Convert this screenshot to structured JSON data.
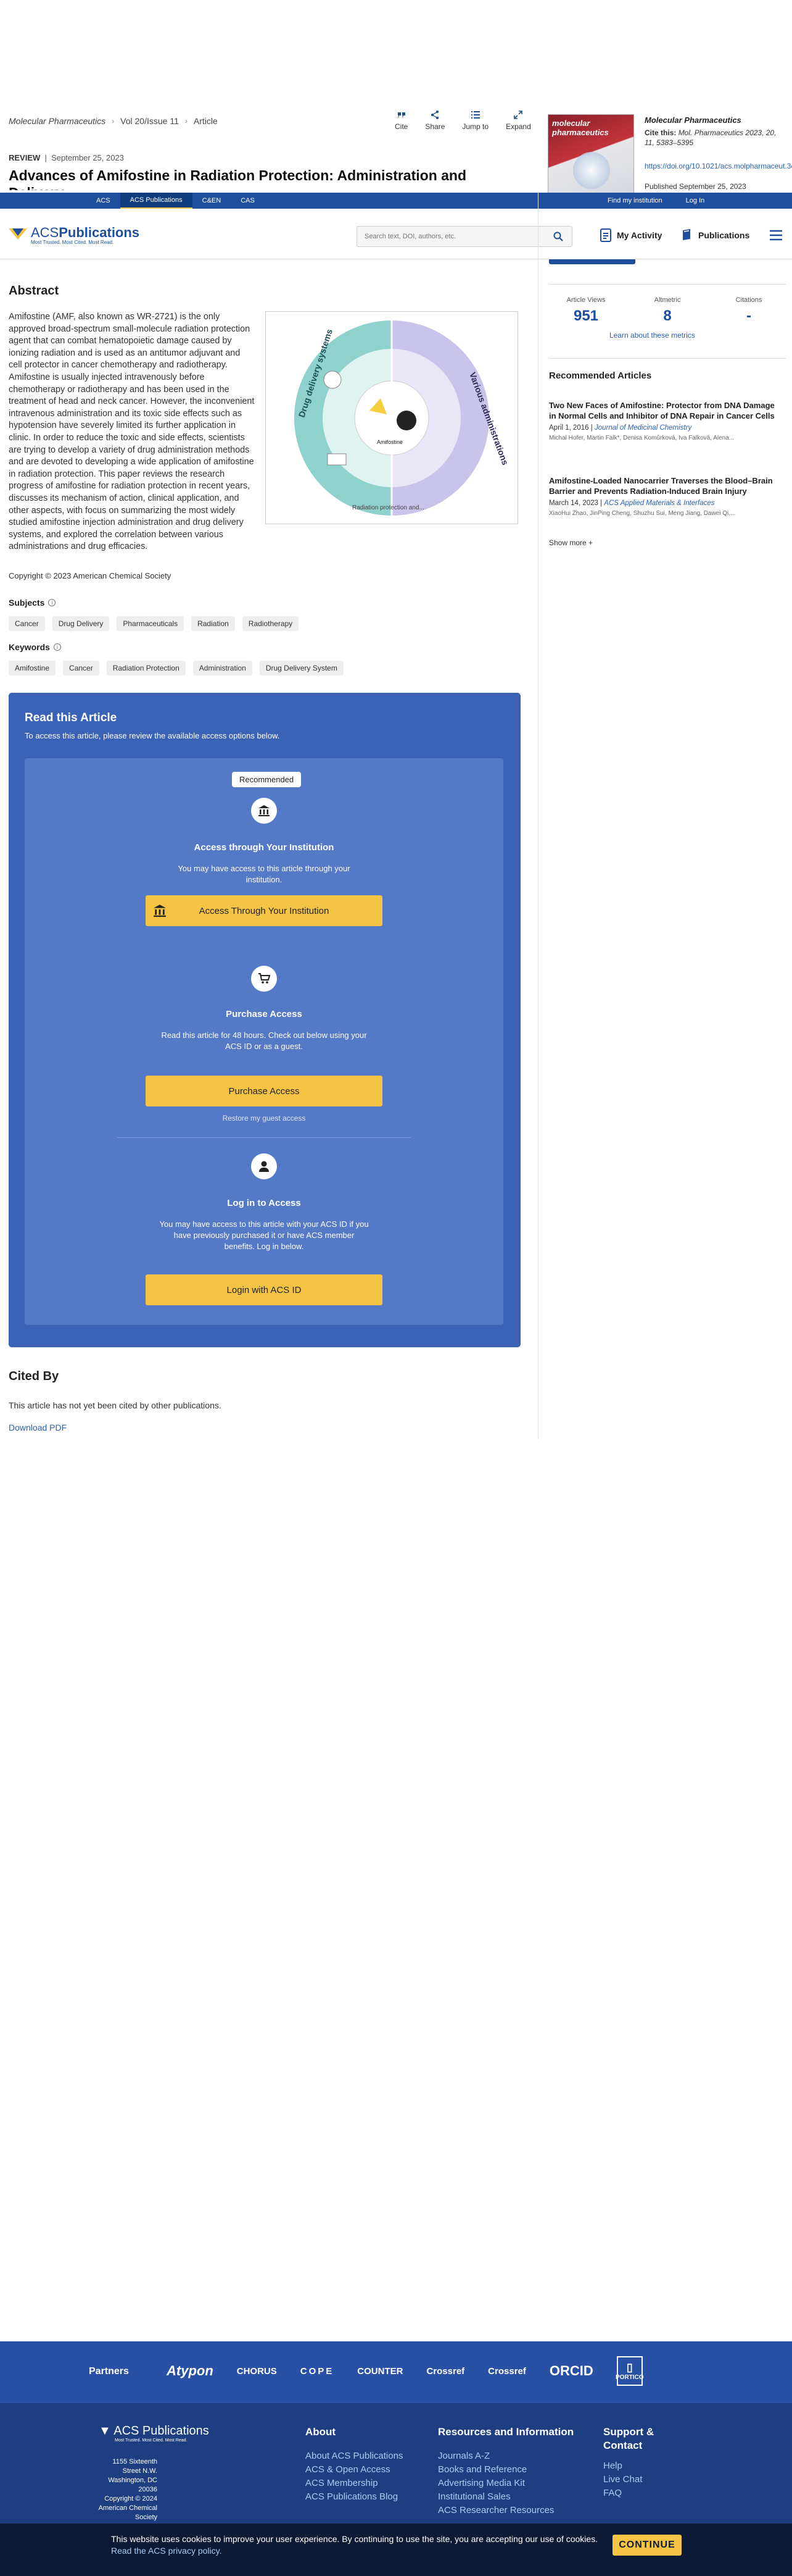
{
  "breadcrumb": {
    "journal": "Molecular Pharmaceutics",
    "volume": "Vol 20/Issue 11",
    "article": "Article"
  },
  "toolbar": {
    "cite": "Cite",
    "share": "Share",
    "jump": "Jump to",
    "expand": "Expand"
  },
  "article": {
    "type": "REVIEW",
    "date": "September 25, 2023",
    "title": "Advances of Amifostine in Radiation Protection: Administration and Delivery"
  },
  "journal_panel": {
    "cover_text": "molecular pharmaceutics",
    "name": "Molecular Pharmaceutics",
    "cite_label": "Cite this:",
    "cite_value": "Mol. Pharmaceutics 2023, 20, 11, 5383–5395",
    "doi": "https://doi.org/10.1021/acs.molpharmaceut.3c00600",
    "published": "Published September 25, 2023"
  },
  "top_nav": {
    "links": [
      "ACS",
      "ACS Publications",
      "C&EN",
      "CAS"
    ],
    "active_index": 1,
    "find_institution": "Find my institution",
    "login": "Log In"
  },
  "header": {
    "logo_name_regular": "ACS",
    "logo_name_bold": "Publications",
    "logo_tagline": "Most Trusted. Most Cited. Most Read.",
    "search_placeholder": "Search text, DOI, authors, etc.",
    "my_activity": "My Activity",
    "publications": "Publications"
  },
  "metrics": {
    "items": [
      {
        "label": "Article Views",
        "value": "951"
      },
      {
        "label": "Altmetric",
        "value": "8"
      },
      {
        "label": "Citations",
        "value": "-"
      }
    ],
    "learn_more": "Learn about these metrics"
  },
  "recommended": {
    "heading": "Recommended Articles",
    "items": [
      {
        "title": "Two New Faces of Amifostine: Protector from DNA Damage in Normal Cells and Inhibitor of DNA Repair in Cancer Cells",
        "date": "April 1, 2016",
        "journal": "Journal of Medicinal Chemistry",
        "authors": "Michal Hofer, Martin Falk*, Denisa Komůrková, Iva Falková, Alena..."
      },
      {
        "title": "Amifostine-Loaded Nanocarrier Traverses the Blood–Brain Barrier and Prevents Radiation-Induced Brain Injury",
        "date": "March 14, 2023",
        "journal": "ACS Applied Materials & Interfaces",
        "authors": "XiaoHui Zhao, JinPing Cheng, Shuzhu Sui, Meng Jiang, Dawei Qi,..."
      }
    ],
    "show_more": "Show more"
  },
  "abstract": {
    "heading": "Abstract",
    "text": "Amifostine (AMF, also known as WR-2721) is the only approved broad-spectrum small-molecule radiation protection agent that can combat hematopoietic damage caused by ionizing radiation and is used as an antitumor adjuvant and cell protector in cancer chemotherapy and radiotherapy. Amifostine is usually injected intravenously before chemotherapy or radiotherapy and has been used in the treatment of head and neck cancer. However, the inconvenient intravenous administration and its toxic side effects such as hypotension have severely limited its further application in clinic. In order to reduce the toxic and side effects, scientists are trying to develop a variety of drug administration methods and are devoted to developing a wide application of amifostine in radiation protection. This paper reviews the research progress of amifostine for radiation protection in recent years, discusses its mechanism of action, clinical application, and other aspects, with focus on summarizing the most widely studied amifostine injection administration and drug delivery systems, and explored the correlation between various administrations and drug efficacies.",
    "toc_left": "Drug delivery systems",
    "toc_right": "Various administrations",
    "toc_bottom": "Radiation protection and...",
    "toc_center": "Amifostine",
    "copyright": "Copyright © 2023 American Chemical Society"
  },
  "subjects": {
    "heading": "Subjects",
    "items": [
      "Cancer",
      "Drug Delivery",
      "Pharmaceuticals",
      "Radiation",
      "Radiotherapy"
    ]
  },
  "keywords": {
    "heading": "Keywords",
    "items": [
      "Amifostine",
      "Cancer",
      "Radiation Protection",
      "Administration",
      "Drug Delivery System"
    ]
  },
  "read_article": {
    "heading": "Read this Article",
    "subheading": "To access this article, please review the available access options below.",
    "recommended_badge": "Recommended",
    "institution": {
      "heading": "Access through Your Institution",
      "text": "You may have access to this article through your institution.",
      "button": "Access Through Your Institution"
    },
    "purchase": {
      "heading": "Purchase Access",
      "text": "Read this article for 48 hours. Check out below using your ACS ID or as a guest.",
      "button": "Purchase Access",
      "restore": "Restore my guest access"
    },
    "login": {
      "heading": "Log in to Access",
      "text": "You may have access to this article with your ACS ID if you have previously purchased it or have ACS member benefits. Log in below.",
      "button": "Login with ACS ID"
    }
  },
  "cited_by": {
    "heading": "Cited By",
    "text": "This article has not yet been cited by other publications.",
    "download": "Download PDF"
  },
  "partners": {
    "heading": "Partners",
    "logos": [
      "Atypon",
      "CHORUS",
      "COPE",
      "COUNTER",
      "Crossref",
      "Crossref",
      "ORCID",
      "PORTICO"
    ]
  },
  "footer": {
    "logo": "ACS Publications",
    "logo_tagline": "Most Trusted. Most Cited. Most Read.",
    "address": [
      "1155 Sixteenth Street N.W.",
      "Washington, DC 20036",
      "Copyright © 2024",
      "American Chemical Society"
    ],
    "about": {
      "heading": "About",
      "links": [
        "About ACS Publications",
        "ACS & Open Access",
        "ACS Membership",
        "ACS Publications Blog"
      ]
    },
    "resources": {
      "heading": "Resources and Information",
      "links": [
        "Journals A-Z",
        "Books and Reference",
        "Advertising Media Kit",
        "Institutional Sales",
        "ACS Researcher Resources"
      ]
    },
    "support": {
      "heading": "Support & Contact",
      "links": [
        "Help",
        "Live Chat",
        "FAQ"
      ]
    }
  },
  "cookie": {
    "text": "This website uses cookies to improve your user experience. By continuing to use the site, you are accepting our use of cookies.",
    "link": "Read the ACS privacy policy.",
    "button": "CONTINUE"
  },
  "colors": {
    "brand_blue": "#1f4f9c",
    "accent_yellow": "#f6c445",
    "panel_blue": "#3a63b8"
  }
}
